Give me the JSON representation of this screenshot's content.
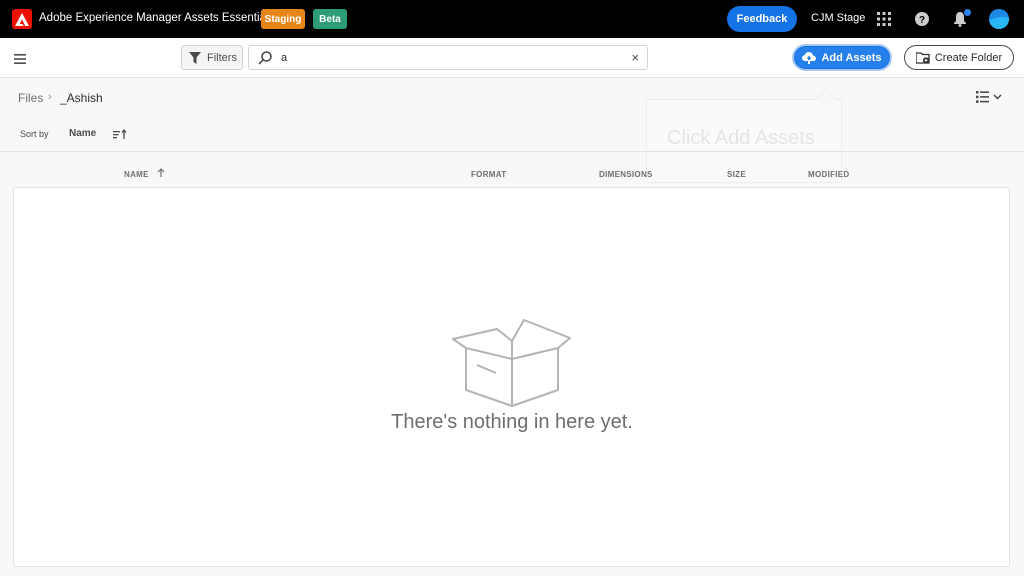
{
  "app": {
    "title": "Adobe Experience Manager Assets Essentials",
    "badges": {
      "staging": "Staging",
      "beta": "Beta"
    },
    "feedback_label": "Feedback",
    "org_name": "CJM Stage"
  },
  "toolbar": {
    "filters_label": "Filters",
    "search_value": "a",
    "clear_symbol": "×",
    "add_assets_label": "Add Assets",
    "create_folder_label": "Create Folder"
  },
  "breadcrumb": {
    "root": "Files",
    "separator": "›",
    "current": "_Ashish"
  },
  "sort": {
    "label": "Sort by",
    "field": "Name"
  },
  "ghost_tip": "Click Add Assets",
  "table": {
    "columns": [
      "NAME",
      "FORMAT",
      "DIMENSIONS",
      "SIZE",
      "MODIFIED"
    ]
  },
  "empty_state": {
    "message": "There's nothing in here yet.",
    "icon": "empty-box-icon"
  },
  "colors": {
    "topbar": "#000000",
    "accent": "#1473e6",
    "staging": "#e68619",
    "beta": "#2d9d78",
    "adobe_red": "#eb1000"
  }
}
